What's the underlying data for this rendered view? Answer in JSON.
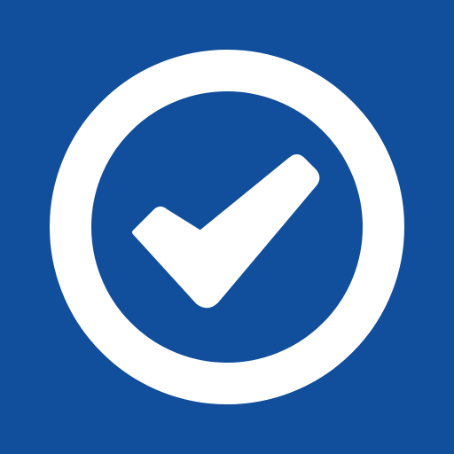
{
  "icon": {
    "name": "check-circle-icon",
    "background_color": "#114e9b",
    "foreground_color": "#ffffff"
  }
}
